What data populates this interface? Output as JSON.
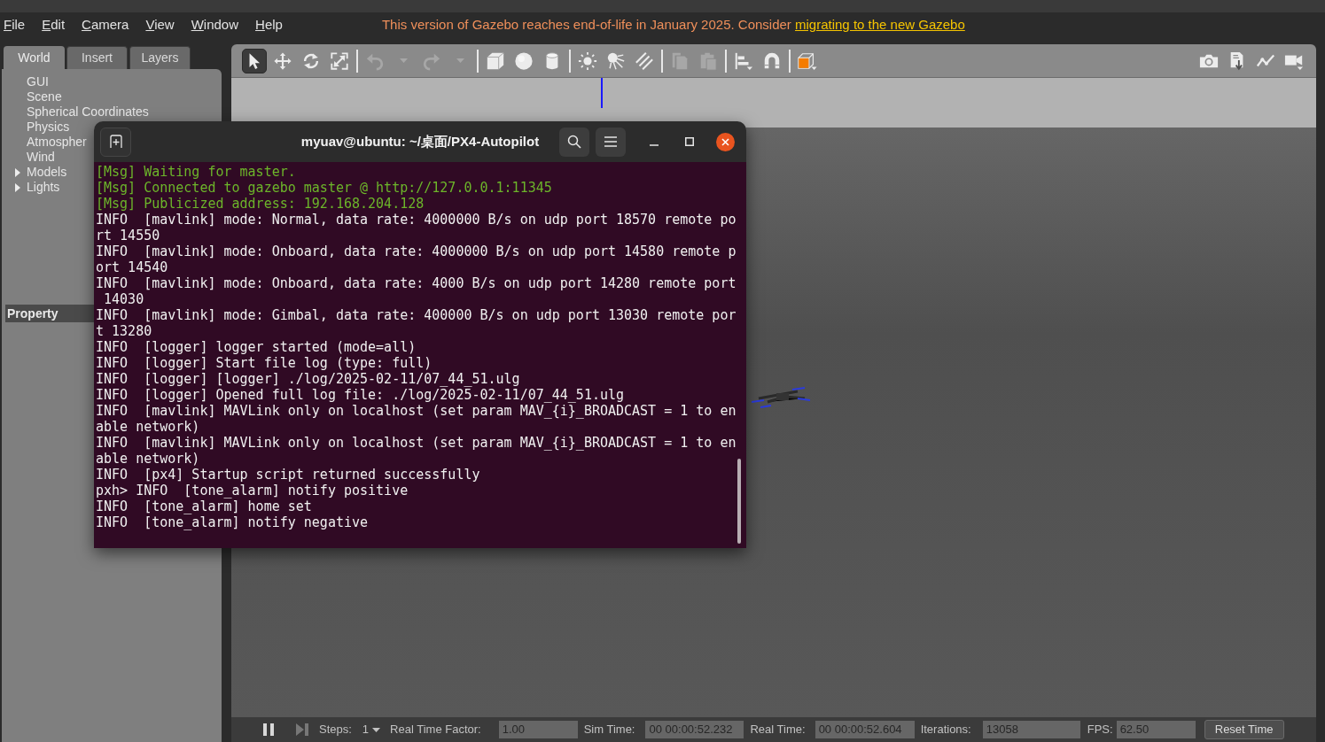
{
  "menu_bar": {
    "items": [
      "File",
      "Edit",
      "Camera",
      "View",
      "Window",
      "Help"
    ],
    "notice": {
      "text": "This version of Gazebo reaches end-of-life in January 2025. Consider",
      "link": "migrating to the new Gazebo"
    }
  },
  "left_panel": {
    "tabs": [
      {
        "label": "World",
        "selected": true
      },
      {
        "label": "Insert",
        "selected": false
      },
      {
        "label": "Layers",
        "selected": false
      }
    ],
    "tree": [
      {
        "label": "GUI",
        "kind": "leaf"
      },
      {
        "label": "Scene",
        "kind": "leaf"
      },
      {
        "label": "Spherical Coordinates",
        "kind": "leaf"
      },
      {
        "label": "Physics",
        "kind": "leaf"
      },
      {
        "label": "Atmospher",
        "kind": "leaf"
      },
      {
        "label": "Wind",
        "kind": "leaf"
      },
      {
        "label": "Models",
        "kind": "group",
        "expanded": false
      },
      {
        "label": "Lights",
        "kind": "group",
        "expanded": false
      }
    ],
    "property_header": "Property"
  },
  "toolbar": {
    "groups": [
      [
        {
          "kind": "select",
          "selected": true
        },
        {
          "kind": "translate",
          "selected": false
        },
        {
          "kind": "rotate",
          "selected": false
        },
        {
          "kind": "scale",
          "selected": false
        }
      ],
      [
        {
          "kind": "undo",
          "disabled": true
        },
        {
          "kind": "redo",
          "disabled": true
        }
      ],
      [
        {
          "kind": "box"
        },
        {
          "kind": "sphere"
        },
        {
          "kind": "cylinder"
        }
      ],
      [
        {
          "kind": "point"
        },
        {
          "kind": "spot"
        },
        {
          "kind": "directional"
        }
      ],
      [
        {
          "kind": "copy",
          "disabled": true
        },
        {
          "kind": "paste",
          "disabled": true
        }
      ],
      [
        {
          "kind": "align"
        },
        {
          "kind": "snap"
        }
      ],
      [
        {
          "kind": "view-angle"
        }
      ]
    ],
    "right": [
      {
        "kind": "screenshot"
      },
      {
        "kind": "log"
      },
      {
        "kind": "plot"
      },
      {
        "kind": "record"
      }
    ]
  },
  "status_bar": {
    "paused": false,
    "steps_label": "Steps:",
    "steps_value": "1",
    "fields": [
      {
        "label": "Real Time Factor:",
        "value": "1.00"
      },
      {
        "label": "Sim Time:",
        "value": "00 00:00:52.232"
      },
      {
        "label": "Real Time:",
        "value": "00 00:00:52.604"
      },
      {
        "label": "Iterations:",
        "value": "13058"
      },
      {
        "label": "FPS:",
        "value": "62.50"
      }
    ],
    "reset_button": "Reset Time"
  },
  "terminal": {
    "title": "myuav@ubuntu: ~/桌面/PX4-Autopilot",
    "lines": [
      {
        "kind": "msg",
        "text": "[Msg] Waiting for master."
      },
      {
        "kind": "msg",
        "text": "[Msg] Connected to gazebo master @ http://127.0.0.1:11345"
      },
      {
        "kind": "msg",
        "text": "[Msg] Publicized address: 192.168.204.128"
      },
      {
        "kind": "log",
        "text": "INFO  [mavlink] mode: Normal, data rate: 4000000 B/s on udp port 18570 remote po"
      },
      {
        "kind": "log",
        "text": "rt 14550"
      },
      {
        "kind": "log",
        "text": "INFO  [mavlink] mode: Onboard, data rate: 4000000 B/s on udp port 14580 remote p"
      },
      {
        "kind": "log",
        "text": "ort 14540"
      },
      {
        "kind": "log",
        "text": "INFO  [mavlink] mode: Onboard, data rate: 4000 B/s on udp port 14280 remote port"
      },
      {
        "kind": "log",
        "text": " 14030"
      },
      {
        "kind": "log",
        "text": "INFO  [mavlink] mode: Gimbal, data rate: 400000 B/s on udp port 13030 remote por"
      },
      {
        "kind": "log",
        "text": "t 13280"
      },
      {
        "kind": "log",
        "text": "INFO  [logger] logger started (mode=all)"
      },
      {
        "kind": "log",
        "text": "INFO  [logger] Start file log (type: full)"
      },
      {
        "kind": "log",
        "text": "INFO  [logger] [logger] ./log/2025-02-11/07_44_51.ulg"
      },
      {
        "kind": "log",
        "text": "INFO  [logger] Opened full log file: ./log/2025-02-11/07_44_51.ulg"
      },
      {
        "kind": "log",
        "text": "INFO  [mavlink] MAVLink only on localhost (set param MAV_{i}_BROADCAST = 1 to en"
      },
      {
        "kind": "log",
        "text": "able network)"
      },
      {
        "kind": "log",
        "text": "INFO  [mavlink] MAVLink only on localhost (set param MAV_{i}_BROADCAST = 1 to en"
      },
      {
        "kind": "log",
        "text": "able network)"
      },
      {
        "kind": "log",
        "text": "INFO  [px4] Startup script returned successfully"
      },
      {
        "kind": "log",
        "text": "pxh> INFO  [tone_alarm] notify positive"
      },
      {
        "kind": "log",
        "text": "INFO  [tone_alarm] home set"
      },
      {
        "kind": "log",
        "text": "INFO  [tone_alarm] notify negative"
      }
    ]
  }
}
